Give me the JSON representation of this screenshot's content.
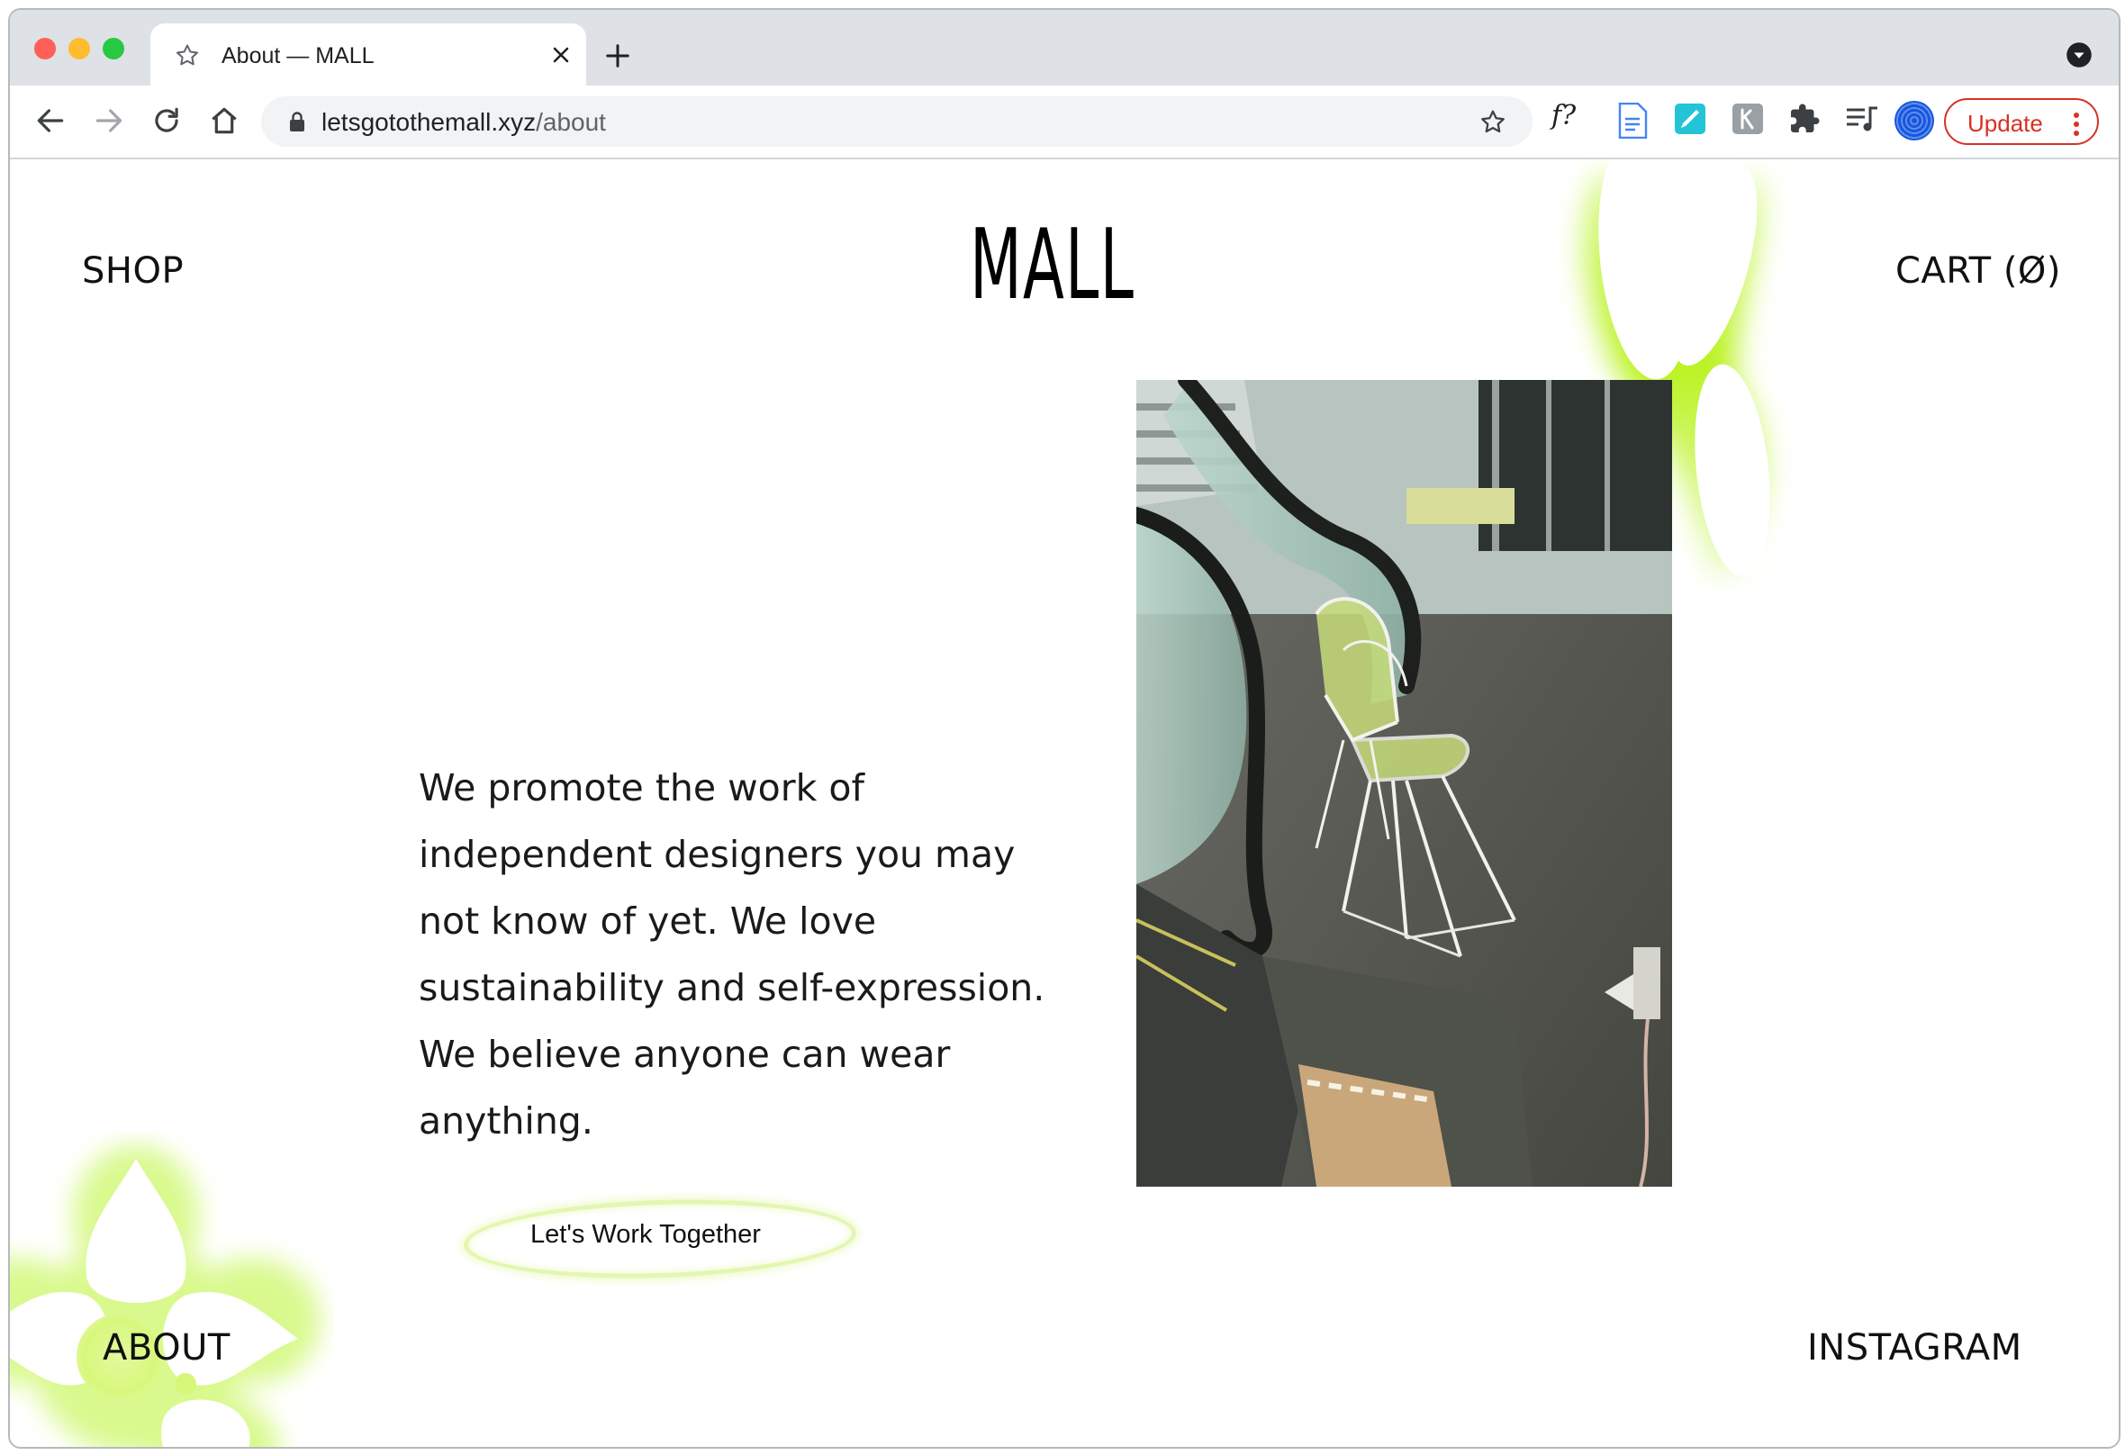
{
  "browser": {
    "tab": {
      "title": "About — MALL"
    },
    "new_tab_label": "+",
    "address": {
      "domain": "letsgotothemall.xyz",
      "path": "/about"
    },
    "extensions": {
      "font_ext_label": "f?"
    },
    "update_label": "Update"
  },
  "site": {
    "logo": "MALL",
    "nav": {
      "shop": "SHOP",
      "cart": "CART (Ø)",
      "about": "ABOUT",
      "instagram": "INSTAGRAM"
    },
    "intro": "We promote the work of independent designers you may not know of yet.  We love sustainability and self-expression. We believe anyone can wear anything.",
    "cta": "Let's Work Together"
  },
  "colors": {
    "accent_lime": "#c6f432",
    "update_red": "#d93025",
    "tabstrip": "#dee1e6"
  },
  "icons": {
    "back": "arrow-left-icon",
    "forward": "arrow-right-icon",
    "reload": "reload-icon",
    "home": "home-icon",
    "lock": "lock-icon",
    "bookmark": "star-icon",
    "extensions": "puzzle-icon",
    "media": "media-queue-icon"
  }
}
